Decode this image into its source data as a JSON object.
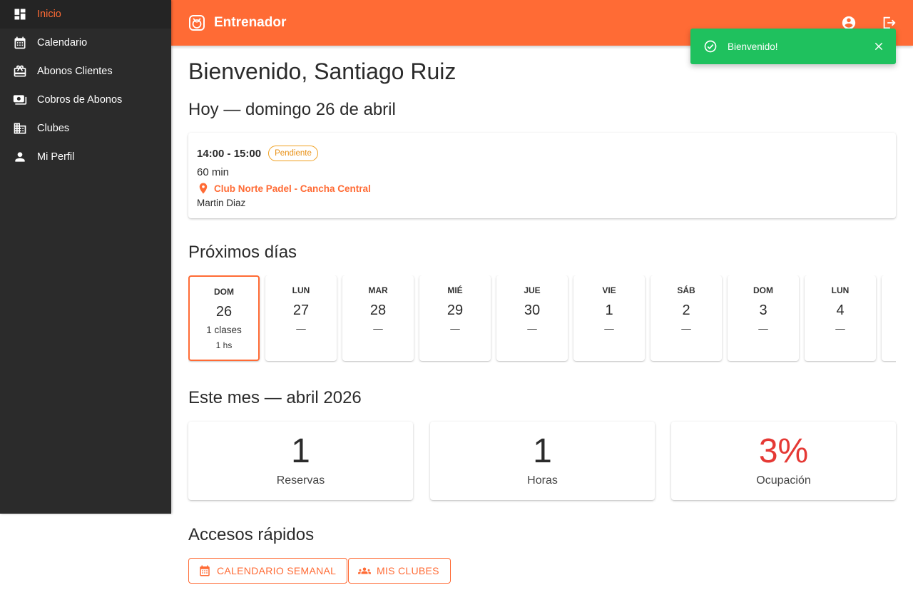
{
  "app": {
    "title": "Entrenador"
  },
  "colors": {
    "accent": "#ff6b35",
    "sidebar": "#2b2b2b",
    "success": "#1fc15e",
    "warning": "#f0a020",
    "danger": "#e53935"
  },
  "sidebar": {
    "items": [
      {
        "label": "Inicio",
        "icon": "dashboard-icon",
        "active": true
      },
      {
        "label": "Calendario",
        "icon": "calendar-icon"
      },
      {
        "label": "Abonos Clientes",
        "icon": "card-giftcard-icon"
      },
      {
        "label": "Cobros de Abonos",
        "icon": "payments-icon"
      },
      {
        "label": "Clubes",
        "icon": "building-icon"
      },
      {
        "label": "Mi Perfil",
        "icon": "person-icon"
      }
    ]
  },
  "toast": {
    "message": "Bienvenido!"
  },
  "main": {
    "welcome": "Bienvenido, Santiago Ruiz",
    "today": {
      "title": "Hoy — domingo 26 de abril",
      "time": "14:00 - 15:00",
      "status": "Pendiente",
      "duration": "60 min",
      "location": "Club Norte Padel - Cancha Central",
      "student": "Martin Diaz"
    },
    "upcoming": {
      "title": "Próximos días",
      "days": [
        {
          "name": "DOM",
          "date": "26",
          "classes": "1 clases",
          "hours": "1 hs",
          "selected": true
        },
        {
          "name": "LUN",
          "date": "27",
          "classes": "—"
        },
        {
          "name": "MAR",
          "date": "28",
          "classes": "—"
        },
        {
          "name": "MIÉ",
          "date": "29",
          "classes": "—"
        },
        {
          "name": "JUE",
          "date": "30",
          "classes": "—"
        },
        {
          "name": "VIE",
          "date": "1",
          "classes": "—"
        },
        {
          "name": "SÁB",
          "date": "2",
          "classes": "—"
        },
        {
          "name": "DOM",
          "date": "3",
          "classes": "—"
        },
        {
          "name": "LUN",
          "date": "4",
          "classes": "—"
        },
        {
          "name": "",
          "date": "",
          "classes": ""
        }
      ]
    },
    "month": {
      "title": "Este mes — abril 2026",
      "stats": [
        {
          "value": "1",
          "label": "Reservas"
        },
        {
          "value": "1",
          "label": "Horas"
        },
        {
          "value": "3%",
          "label": "Ocupación"
        }
      ]
    },
    "quick": {
      "title": "Accesos rápidos",
      "buttons": [
        {
          "label": "CALENDARIO SEMANAL",
          "icon": "calendar-icon"
        },
        {
          "label": "MIS CLUBES",
          "icon": "groups-icon"
        }
      ]
    }
  }
}
